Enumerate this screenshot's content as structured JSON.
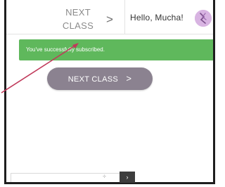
{
  "header": {
    "nav_next_line1": "NEXT",
    "nav_next_line2": "CLASS",
    "nav_chevron": ">",
    "greeting": "Hello, Mucha!"
  },
  "alert": {
    "message": "You've successfully subscribed.",
    "color": "#5fb85c"
  },
  "main": {
    "next_class_label": "NEXT CLASS",
    "next_class_chevron": ">",
    "button_color": "#8b8290"
  },
  "footer": {
    "stepper_glyph": "÷",
    "go_glyph": "›"
  },
  "icons": {
    "avatar": "avatar-icon",
    "annotation_arrow": "arrow-icon"
  },
  "colors": {
    "arrow": "#c0395a"
  }
}
